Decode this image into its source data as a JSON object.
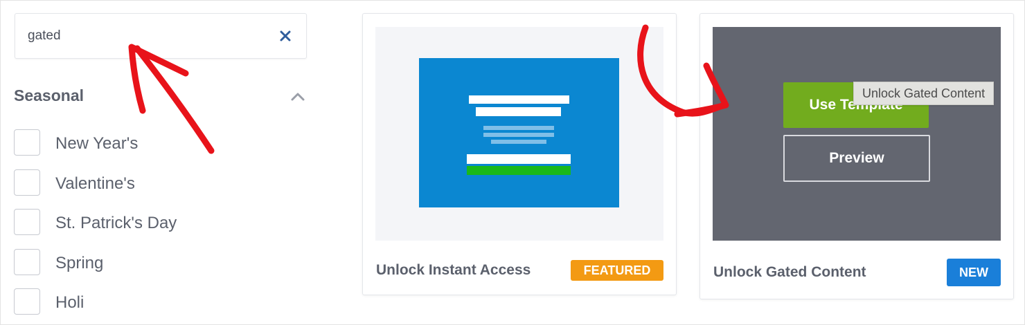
{
  "search": {
    "value": "gated",
    "clear_icon": "close-icon"
  },
  "filters": {
    "section_title": "Seasonal",
    "collapse_icon": "chevron-up-icon",
    "items": [
      {
        "label": "New Year's",
        "checked": false
      },
      {
        "label": "Valentine's",
        "checked": false
      },
      {
        "label": "St. Patrick's Day",
        "checked": false
      },
      {
        "label": "Spring",
        "checked": false
      },
      {
        "label": "Holi",
        "checked": false
      }
    ]
  },
  "templates": [
    {
      "title": "Unlock Instant Access",
      "badge": "FEATURED"
    },
    {
      "title": "Unlock Gated Content",
      "badge": "NEW",
      "hover_actions": {
        "use_label": "Use Template",
        "preview_label": "Preview"
      },
      "tooltip": "Unlock Gated Content"
    }
  ],
  "colors": {
    "accent_green": "#72ac1e",
    "featured_orange": "#f39a13",
    "new_blue": "#1a7fd9",
    "annotation_red": "#e8131a"
  }
}
